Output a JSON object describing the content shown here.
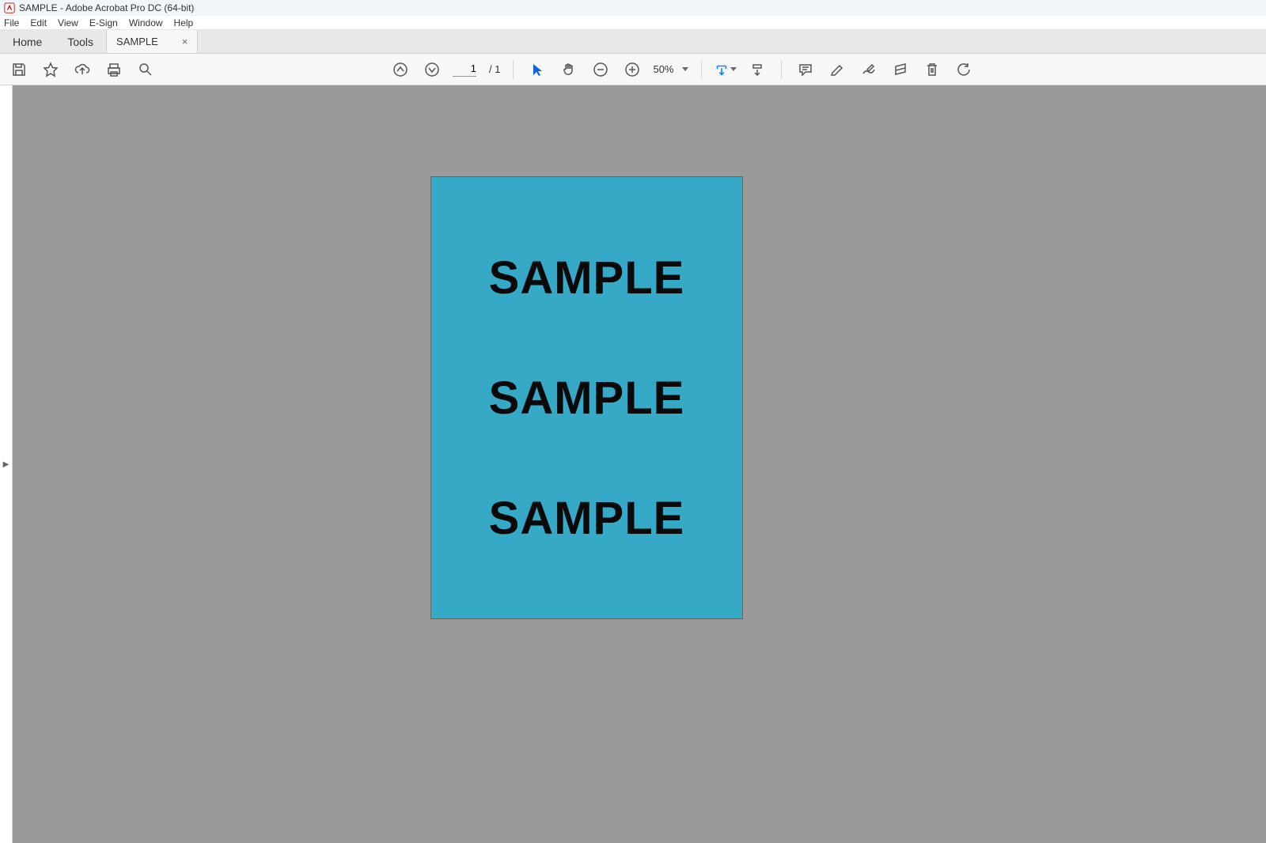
{
  "titlebar": {
    "text": "SAMPLE - Adobe Acrobat Pro DC (64-bit)"
  },
  "menu": [
    "File",
    "Edit",
    "View",
    "E-Sign",
    "Window",
    "Help"
  ],
  "tabs": {
    "home": "Home",
    "tools": "Tools",
    "document": "SAMPLE",
    "close": "×"
  },
  "toolbar": {
    "page_current": "1",
    "page_total": "/ 1",
    "zoom": "50%"
  },
  "document": {
    "lines": [
      "SAMPLE",
      "SAMPLE",
      "SAMPLE"
    ]
  }
}
